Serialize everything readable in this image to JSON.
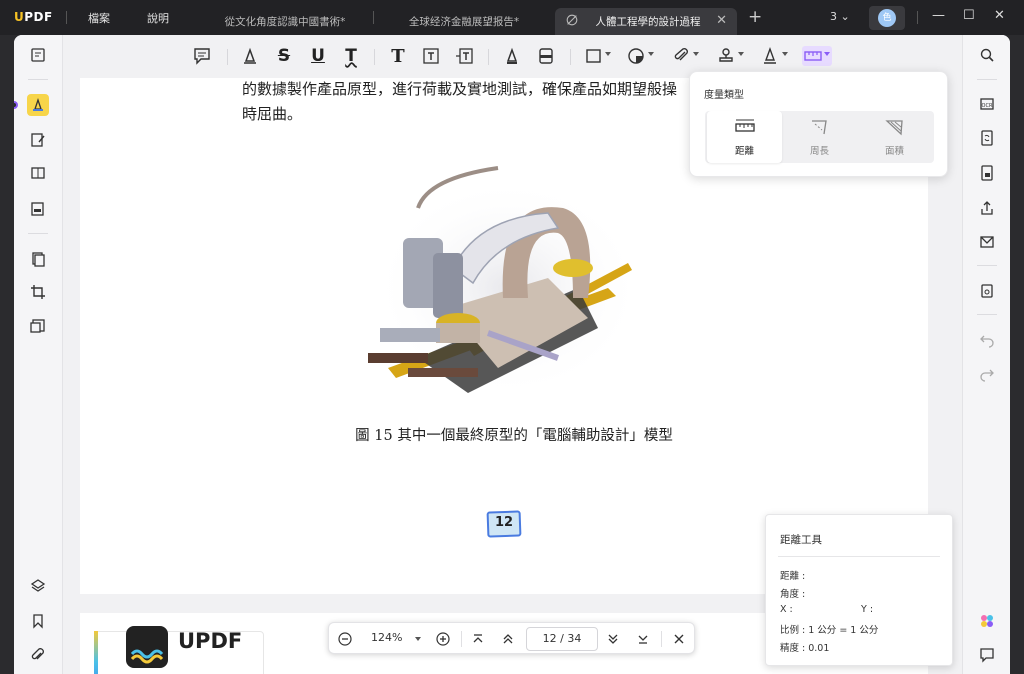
{
  "app": {
    "logo": "UPDF",
    "menu": [
      "檔案",
      "說明"
    ],
    "tabs": [
      {
        "title": "從文化角度認識中國書術*",
        "active": false
      },
      {
        "title": "全球经济金融展望报告*",
        "active": false
      },
      {
        "title": "人體工程學的設計過程",
        "active": true
      }
    ],
    "tab_count": "3",
    "avatar_letter": "色"
  },
  "toolbar": {
    "icons": [
      "comment-icon",
      "highlight-icon",
      "strikethrough-icon",
      "underline-icon",
      "squiggly-icon",
      "text-icon",
      "textbox-icon",
      "textcallout-icon",
      "pencil-icon",
      "eraser-icon",
      "shape-icon",
      "sticker-icon",
      "attachment-icon",
      "stamp-icon",
      "signature-icon",
      "measure-icon"
    ],
    "active_tool": "measure-icon"
  },
  "document": {
    "line1": "的數據製作產品原型，進行荷載及實地測試，確保產品如期望般操",
    "line2": "時屈曲。",
    "caption": "圖 15  其中一個最終原型的「電腦輔助設計」模型",
    "page_label": "12",
    "page2_logo": "UPDF"
  },
  "measure_popover": {
    "title": "度量類型",
    "options": [
      {
        "label": "距離",
        "active": true
      },
      {
        "label": "周長",
        "active": false
      },
      {
        "label": "面積",
        "active": false
      }
    ]
  },
  "distance_panel": {
    "title": "距離工具",
    "distance": "距離 :",
    "angle": "角度 :",
    "x": "X :",
    "y": "Y :",
    "scale": "比例 : 1 公分 = 1 公分",
    "precision": "精度 : 0.01"
  },
  "zoombar": {
    "zoom": "124%",
    "current_page": "12",
    "separator": "/",
    "total_pages": "34"
  },
  "colors": {
    "accent_yellow": "#f7d54a",
    "measure_active": "#e7dbff",
    "titlebar": "#222225"
  }
}
